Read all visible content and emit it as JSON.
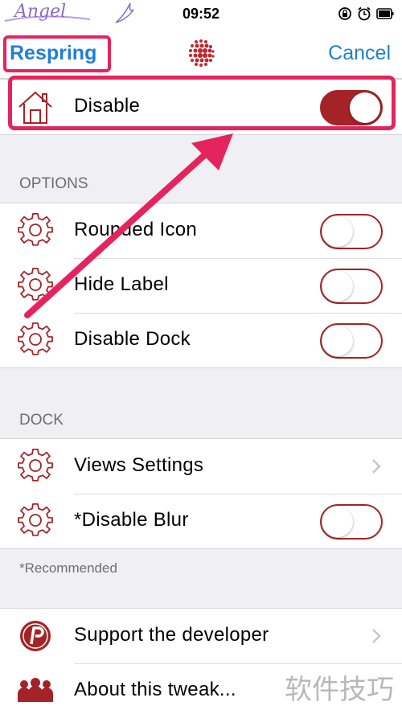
{
  "status_bar": {
    "carrier": "Angel",
    "time": "09:52",
    "icons": [
      "rotation-lock-icon",
      "alarm-icon",
      "battery-icon"
    ]
  },
  "nav": {
    "left_button": "Respring",
    "right_button": "Cancel",
    "logo_icon": "dot-sphere-icon"
  },
  "main_toggle": {
    "label": "Disable",
    "icon": "home-icon",
    "on": true
  },
  "options": {
    "header": "OPTIONS",
    "items": [
      {
        "label": "Rounded Icon",
        "icon": "gear-icon",
        "on": false
      },
      {
        "label": "Hide Label",
        "icon": "gear-icon",
        "on": false
      },
      {
        "label": "Disable Dock",
        "icon": "gear-icon",
        "on": false
      }
    ]
  },
  "dock": {
    "header": "DOCK",
    "items": [
      {
        "label": "Views Settings",
        "icon": "gear-icon",
        "type": "link"
      },
      {
        "label": "*Disable Blur",
        "icon": "gear-icon",
        "on": false
      }
    ],
    "footnote": "*Recommended"
  },
  "about": {
    "items": [
      {
        "label": "Support the developer",
        "icon": "paypal-icon"
      },
      {
        "label": "About this tweak...",
        "icon": "people-icon"
      }
    ]
  },
  "watermark": "软件技巧",
  "colors": {
    "accent": "#a42326",
    "link": "#1f7fd6",
    "highlight": "#e5245e"
  }
}
